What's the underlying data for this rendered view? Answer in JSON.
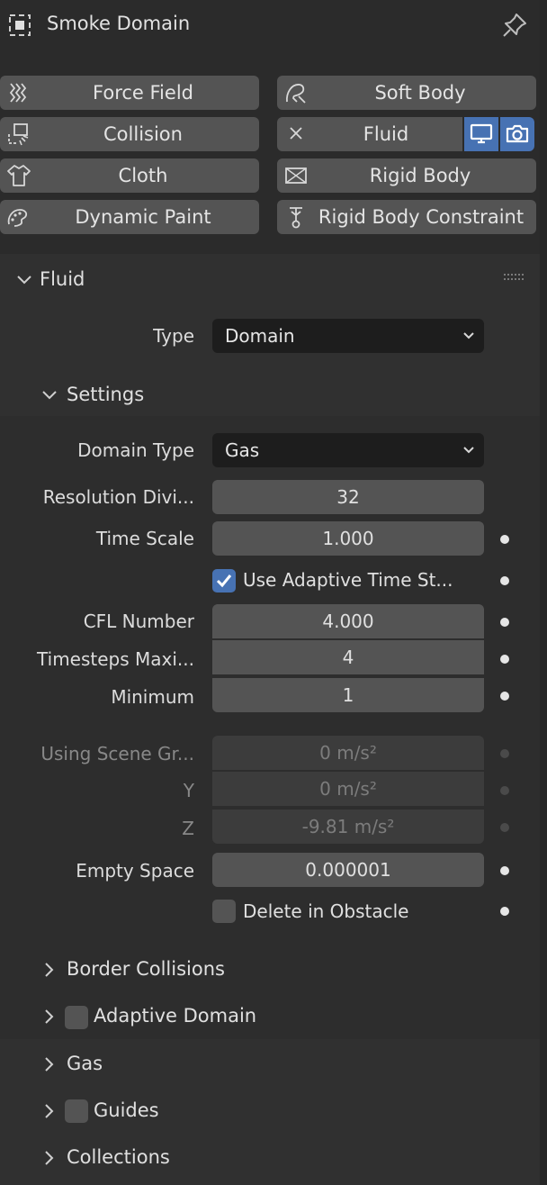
{
  "header": {
    "title": "Smoke Domain",
    "object_icon": "object-square-icon",
    "pin_icon": "pin-icon"
  },
  "physics_buttons": [
    {
      "label": "Force Field",
      "icon": "force-field-icon"
    },
    {
      "label": "Soft Body",
      "icon": "soft-body-icon"
    },
    {
      "label": "Collision",
      "icon": "collision-icon"
    },
    {
      "label": "Fluid",
      "icon": "close-icon",
      "enabled": true
    },
    {
      "label": "Cloth",
      "icon": "cloth-icon"
    },
    {
      "label": "Rigid Body",
      "icon": "rigid-body-icon"
    },
    {
      "label": "Dynamic Paint",
      "icon": "dynamic-paint-icon"
    },
    {
      "label": "Rigid Body Constraint",
      "icon": "rigid-body-constraint-icon"
    }
  ],
  "fluid_panel": {
    "title": "Fluid",
    "type_label": "Type",
    "type_value": "Domain",
    "settings": {
      "title": "Settings",
      "domain_type_label": "Domain Type",
      "domain_type_value": "Gas",
      "resolution_label": "Resolution Divi...",
      "resolution_value": "32",
      "time_scale_label": "Time Scale",
      "time_scale_value": "1.000",
      "adaptive_time_label": "Use Adaptive Time St...",
      "adaptive_time_checked": true,
      "cfl_label": "CFL Number",
      "cfl_value": "4.000",
      "timesteps_max_label": "Timesteps Maxi...",
      "timesteps_max_value": "4",
      "minimum_label": "Minimum",
      "minimum_value": "1",
      "gravity_label": "Using Scene Gr...",
      "gravity_x": "0 m/s²",
      "gravity_y_label": "Y",
      "gravity_y": "0 m/s²",
      "gravity_z_label": "Z",
      "gravity_z": "-9.81 m/s²",
      "empty_space_label": "Empty Space",
      "empty_space_value": "0.000001",
      "delete_obstacle_label": "Delete in Obstacle",
      "delete_obstacle_checked": false
    },
    "subsections": {
      "border_collisions": "Border Collisions",
      "adaptive_domain": "Adaptive Domain",
      "gas": "Gas",
      "guides": "Guides",
      "collections": "Collections"
    }
  },
  "colors": {
    "accent": "#4772b3",
    "background": "#2b2b2b",
    "button": "#545454"
  }
}
